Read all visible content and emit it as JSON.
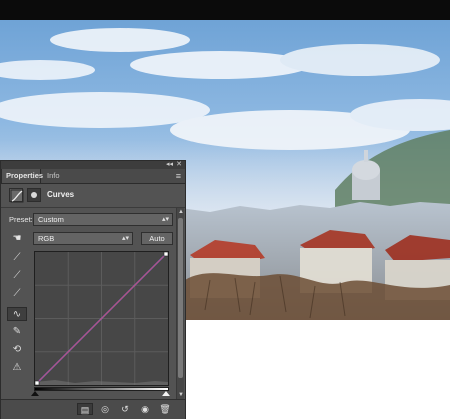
{
  "panel": {
    "tabs": [
      {
        "label": "Properties"
      },
      {
        "label": "Info"
      }
    ],
    "collapse_glyph": "◂◂",
    "close_glyph": "✕",
    "menu_glyph": "≡",
    "title": "Curves",
    "preset": {
      "label": "Preset:",
      "value": "Custom"
    },
    "channel": {
      "value": "RGB"
    },
    "auto_button_label": "Auto",
    "icons": {
      "header_curves": "curves-adjustment-icon",
      "header_mask": "layer-mask-icon",
      "tools": [
        "eyedropper-icon",
        "eyedropper-gray-icon",
        "eyedropper-white-icon",
        "curve-tool-icon",
        "pencil-icon",
        "smooth-icon",
        "clipping-warning-icon"
      ],
      "bottom": [
        "clip-to-layer-icon",
        "view-previous-state-icon",
        "reset-icon",
        "visibility-icon",
        "trash-icon"
      ]
    },
    "curve": {
      "points": [
        [
          0,
          0
        ],
        [
          255,
          255
        ]
      ]
    },
    "colors": {
      "panel_bg": "#535353",
      "curve_line": "#7c6cf5",
      "curve_line_alt": "#d44"
    }
  }
}
